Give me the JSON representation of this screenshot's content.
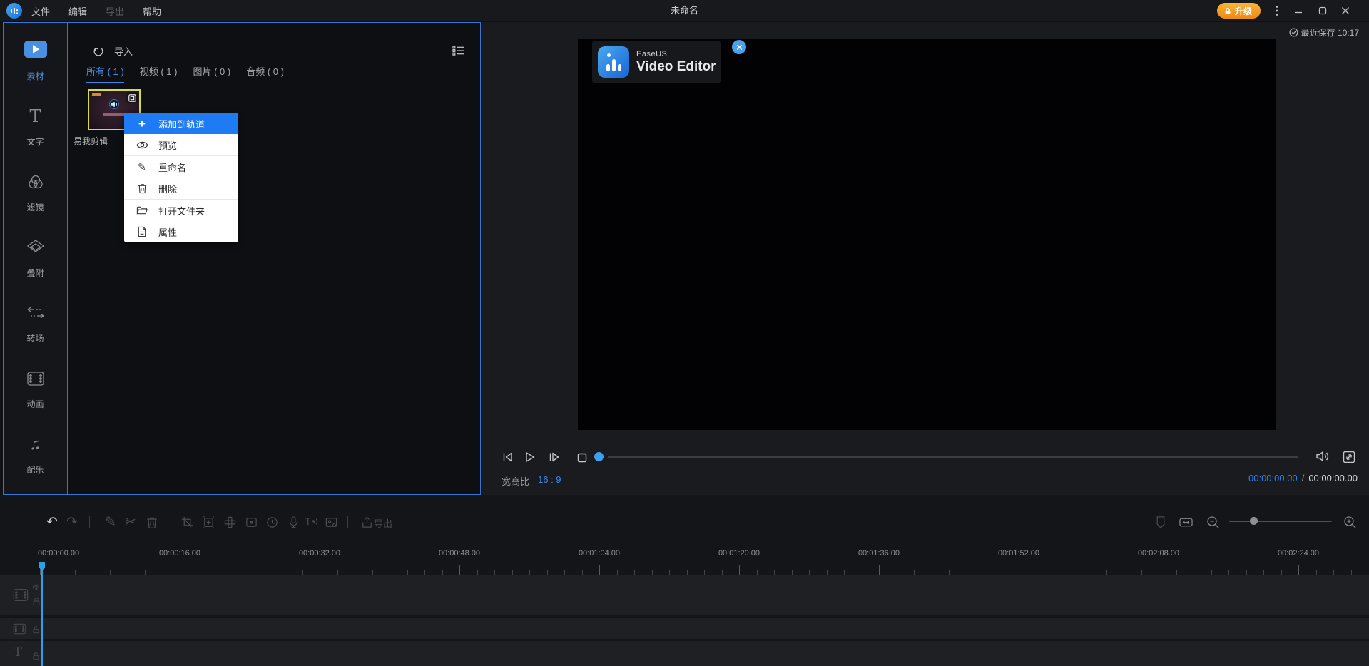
{
  "titlebar": {
    "menu_file": "文件",
    "menu_edit": "编辑",
    "menu_export": "导出",
    "menu_help": "帮助",
    "title": "未命名",
    "upgrade_label": "升级"
  },
  "sidebar": {
    "items": [
      {
        "label": "素材"
      },
      {
        "label": "文字"
      },
      {
        "label": "滤镜"
      },
      {
        "label": "叠附"
      },
      {
        "label": "转场"
      },
      {
        "label": "动画"
      },
      {
        "label": "配乐"
      }
    ]
  },
  "media_panel": {
    "import_label": "导入",
    "tabs": [
      {
        "label": "所有 ( 1 )"
      },
      {
        "label": "视频 ( 1 )"
      },
      {
        "label": "图片 ( 0 )"
      },
      {
        "label": "音频 ( 0 )"
      }
    ],
    "clip_name": "易我剪辑"
  },
  "context_menu": {
    "items": [
      {
        "label": "添加到轨道"
      },
      {
        "label": "预览"
      },
      {
        "label": "重命名"
      },
      {
        "label": "删除"
      },
      {
        "label": "打开文件夹"
      },
      {
        "label": "属性"
      }
    ]
  },
  "preview": {
    "saved_status": "最近保存 10:17",
    "watermark_brand": "EaseUS",
    "watermark_product": "Video Editor",
    "aspect_label": "宽高比",
    "aspect_value": "16 : 9",
    "current_time": "00:00:00.00",
    "time_separator": "/",
    "total_time": "00:00:00.00"
  },
  "toolbar": {
    "export_label": "导出"
  },
  "timeline": {
    "ruler_labels": [
      "00:00:00.00",
      "00:00:16.00",
      "00:00:32.00",
      "00:00:48.00",
      "00:01:04.00",
      "00:01:20.00",
      "00:01:36.00",
      "00:01:52.00",
      "00:02:08.00",
      "00:02:24.00"
    ]
  },
  "colors": {
    "accent_blue": "#3575d3",
    "menu_highlight": "#1f7bf4",
    "upgrade_orange": "#f09a1e",
    "selection_yellow": "#d8dc4b",
    "playhead": "#2ba0ea"
  }
}
